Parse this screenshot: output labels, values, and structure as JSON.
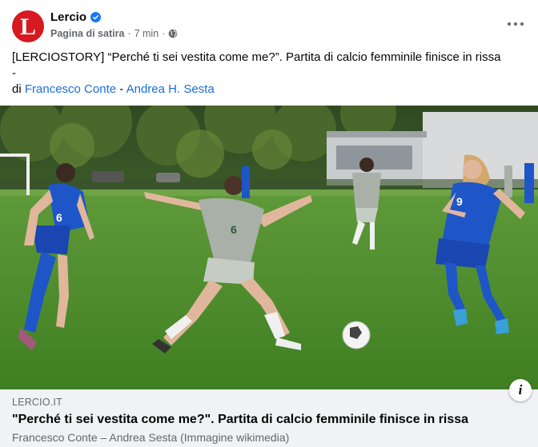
{
  "header": {
    "avatar_letter": "L",
    "page_name": "Lercio",
    "category": "Pagina di satira",
    "separator": "·",
    "time": "7 min",
    "separator2": "·"
  },
  "post": {
    "line1": "[LERCIOSTORY] “Perché ti sei vestita come me?”. Partita di calcio femminile finisce in rissa",
    "line2": "-",
    "by_prefix": "di",
    "author1": "Francesco Conte",
    "author_sep": "-",
    "author2": "Andrea H. Sesta"
  },
  "photo": {
    "jersey_numbers": [
      "6",
      "6",
      "9"
    ]
  },
  "link": {
    "domain": "LERCIO.IT",
    "title": "\"Perché ti sei vestita come me?\". Partita di calcio femminile finisce in rissa",
    "description": "Francesco Conte – Andrea Sesta (Immagine wikimedia)",
    "info_glyph": "i"
  },
  "colors": {
    "brand_red": "#d71920",
    "link_blue": "#1a6ed8",
    "verified_blue": "#1877f2",
    "muted": "#65676b"
  },
  "icons": [
    "verified-badge-icon",
    "globe-icon",
    "more-options-icon",
    "info-icon"
  ]
}
